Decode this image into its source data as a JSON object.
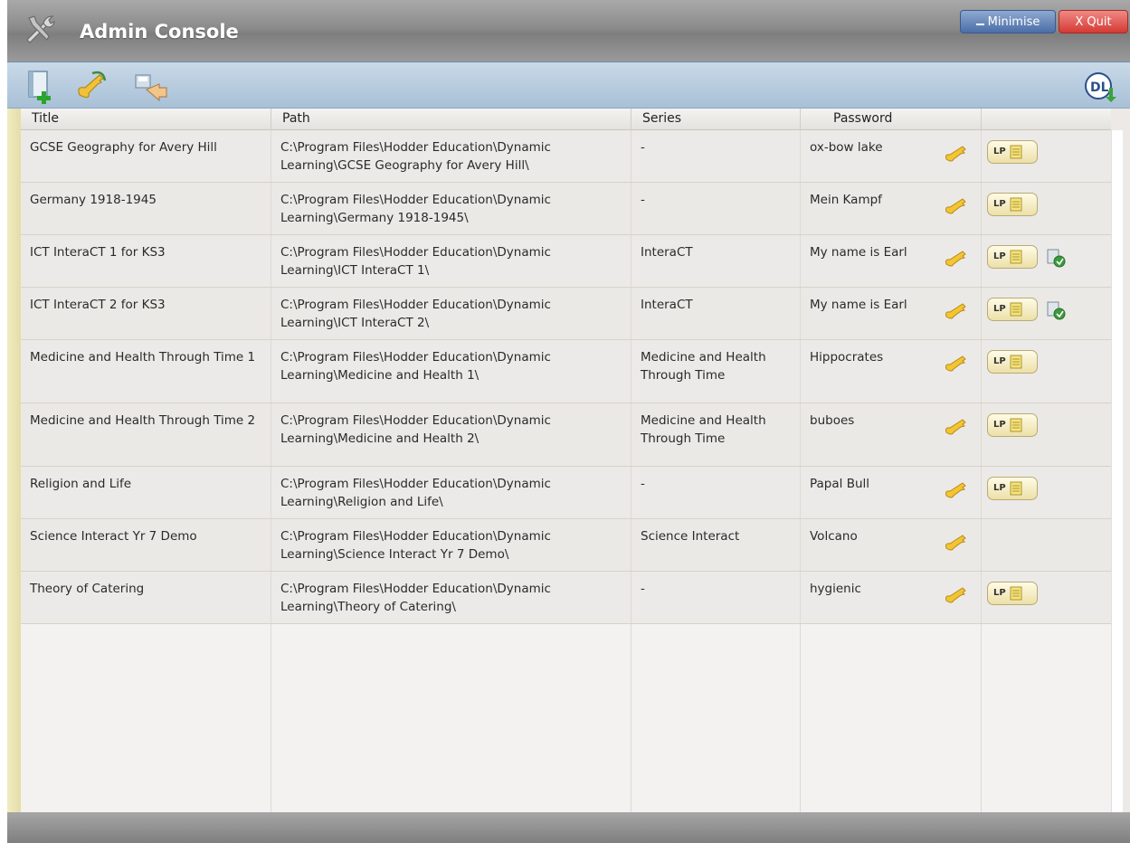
{
  "window": {
    "title": "Admin Console",
    "minimise_label": "Minimise",
    "quit_label": "X Quit"
  },
  "toolbar": {
    "buttons": [
      "add-title-icon",
      "password-key-icon",
      "import-icon",
      "dl-update-icon"
    ]
  },
  "table": {
    "columns": [
      "Title",
      "Path",
      "Series",
      "Password"
    ],
    "rows": [
      {
        "title": "GCSE Geography for Avery Hill",
        "path_line1": "C:\\Program Files\\Hodder Education\\Dynamic",
        "path_line2": "Learning\\GCSE Geography for Avery Hill\\",
        "series": "-",
        "password": "ox-bow lake",
        "lp": "LP",
        "extra": false
      },
      {
        "title": "Germany 1918-1945",
        "path_line1": "C:\\Program Files\\Hodder Education\\Dynamic",
        "path_line2": "Learning\\Germany 1918-1945\\",
        "series": "-",
        "password": "Mein Kampf",
        "lp": "LP",
        "extra": false
      },
      {
        "title": "ICT InteraCT 1 for KS3",
        "path_line1": "C:\\Program Files\\Hodder Education\\Dynamic",
        "path_line2": "Learning\\ICT InteraCT 1\\",
        "series": "InteraCT",
        "password": "My name is Earl",
        "lp": "LP",
        "extra": true
      },
      {
        "title": "ICT InteraCT 2 for KS3",
        "path_line1": "C:\\Program Files\\Hodder Education\\Dynamic",
        "path_line2": "Learning\\ICT InteraCT 2\\",
        "series": "InteraCT",
        "password": "My name is Earl",
        "lp": "LP",
        "extra": true
      },
      {
        "title": "Medicine and Health Through Time 1",
        "path_line1": "C:\\Program Files\\Hodder Education\\Dynamic",
        "path_line2": "Learning\\Medicine and Health 1\\",
        "series": "Medicine and Health Through Time",
        "password": "Hippocrates",
        "lp": "LP",
        "extra": false
      },
      {
        "title": "Medicine and Health Through Time 2",
        "path_line1": "C:\\Program Files\\Hodder Education\\Dynamic",
        "path_line2": "Learning\\Medicine and Health 2\\",
        "series": "Medicine and Health Through Time",
        "password": "buboes",
        "lp": "LP",
        "extra": false
      },
      {
        "title": "Religion and Life",
        "path_line1": "C:\\Program Files\\Hodder Education\\Dynamic",
        "path_line2": "Learning\\Religion and Life\\",
        "series": "-",
        "password": "Papal Bull",
        "lp": "LP",
        "extra": false
      },
      {
        "title": "Science Interact Yr 7 Demo",
        "path_line1": "C:\\Program Files\\Hodder Education\\Dynamic",
        "path_line2": "Learning\\Science Interact Yr 7 Demo\\",
        "series": "Science Interact",
        "password": "Volcano",
        "lp": "",
        "extra": false
      },
      {
        "title": "Theory of Catering",
        "path_line1": "C:\\Program Files\\Hodder Education\\Dynamic",
        "path_line2": "Learning\\Theory of Catering\\",
        "series": "-",
        "password": "hygienic",
        "lp": "LP",
        "extra": false
      }
    ]
  },
  "colors": {
    "titlebar": "#8b8b8c",
    "toolbar": "#b8cde0",
    "minimise": "#4a6ea8",
    "quit": "#d43a33",
    "key": "#e8b020"
  }
}
